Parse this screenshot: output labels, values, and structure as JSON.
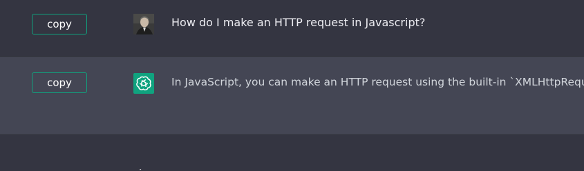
{
  "conversation": {
    "user_message": {
      "copy_label": "copy",
      "text": "How do I make an HTTP request in Javascript?"
    },
    "assistant_message": {
      "copy_label": "copy",
      "text": "In JavaScript, you can make an HTTP request using the built-in `XMLHttpRequest"
    }
  },
  "colors": {
    "background": "#343541",
    "assistant_background": "#444654",
    "accent": "#10a37f",
    "text": "#ececf1"
  },
  "icons": {
    "user_avatar": "user-photo",
    "assistant_avatar": "openai-logo-icon",
    "pin": "pin-icon"
  }
}
